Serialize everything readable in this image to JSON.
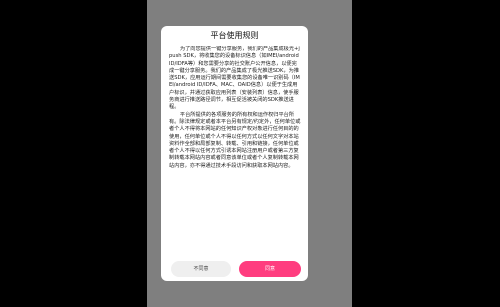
{
  "dialog": {
    "title": "平台使用规则",
    "paragraphs": [
      "为了向您提供一键分享服务，我们的产品集成极光+jpush SDK，将收集您的设备标识信息（如IMEI/android ID/IDFA等）和您需要分享的社交账户公开信息，以便完成一键分享服务。我们的产品集成了极光推送SDK，为推送SDK，应用运行期间需要收集您的设备唯一识别码（IMEI/android ID/IDFA、MAC、OAID信息）以便于生成用户标识，并通过获取应用列表（安装列表）信息，使手服务商进行推送路径调节，相互促活被关闭的SDK推送进程。",
      "平台所提供的各项服务的所有权和运作权归平台所有。除法律规定或者本平台另有规定/约定外，任何单位或者个人不得将本网站的任何知识产权对象进行任何目的的使用，任何单位或个人不得以任何方式以任何文字对本站资料作全部和局部复制、转载、引用和链接，任何单位或者个人不得以任何方式引诱本网站注册用户或者第三方复制转载本网站内容或者同意该单位或者个人复制转载本网站内容，亦不得通过技术手段访问和获取本网站内容。"
    ],
    "disagree_label": "不同意",
    "agree_label": "同意"
  },
  "colors": {
    "overlay": "#7f7f7f",
    "agree_button": "#ff3d7f",
    "disagree_button": "#efefef"
  }
}
